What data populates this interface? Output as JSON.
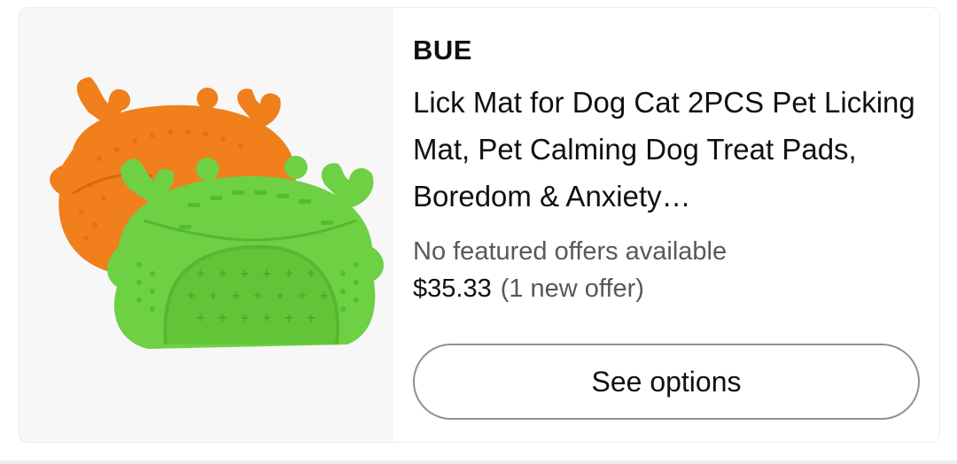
{
  "product": {
    "brand": "BUE",
    "title": "Lick Mat for Dog Cat 2PCS Pet Licking Mat, Pet Calming Dog Treat Pads, Boredom & Anxiety…",
    "offers_status": "No featured offers available",
    "price": "$35.33",
    "new_offer": "(1 new offer)",
    "image_icon": "lick-mat-product-image",
    "colors": {
      "orange_mat": "#f07f1c",
      "green_mat": "#6ed043",
      "text_primary": "#0f1111",
      "text_secondary": "#565959"
    }
  },
  "actions": {
    "see_options_label": "See options"
  }
}
